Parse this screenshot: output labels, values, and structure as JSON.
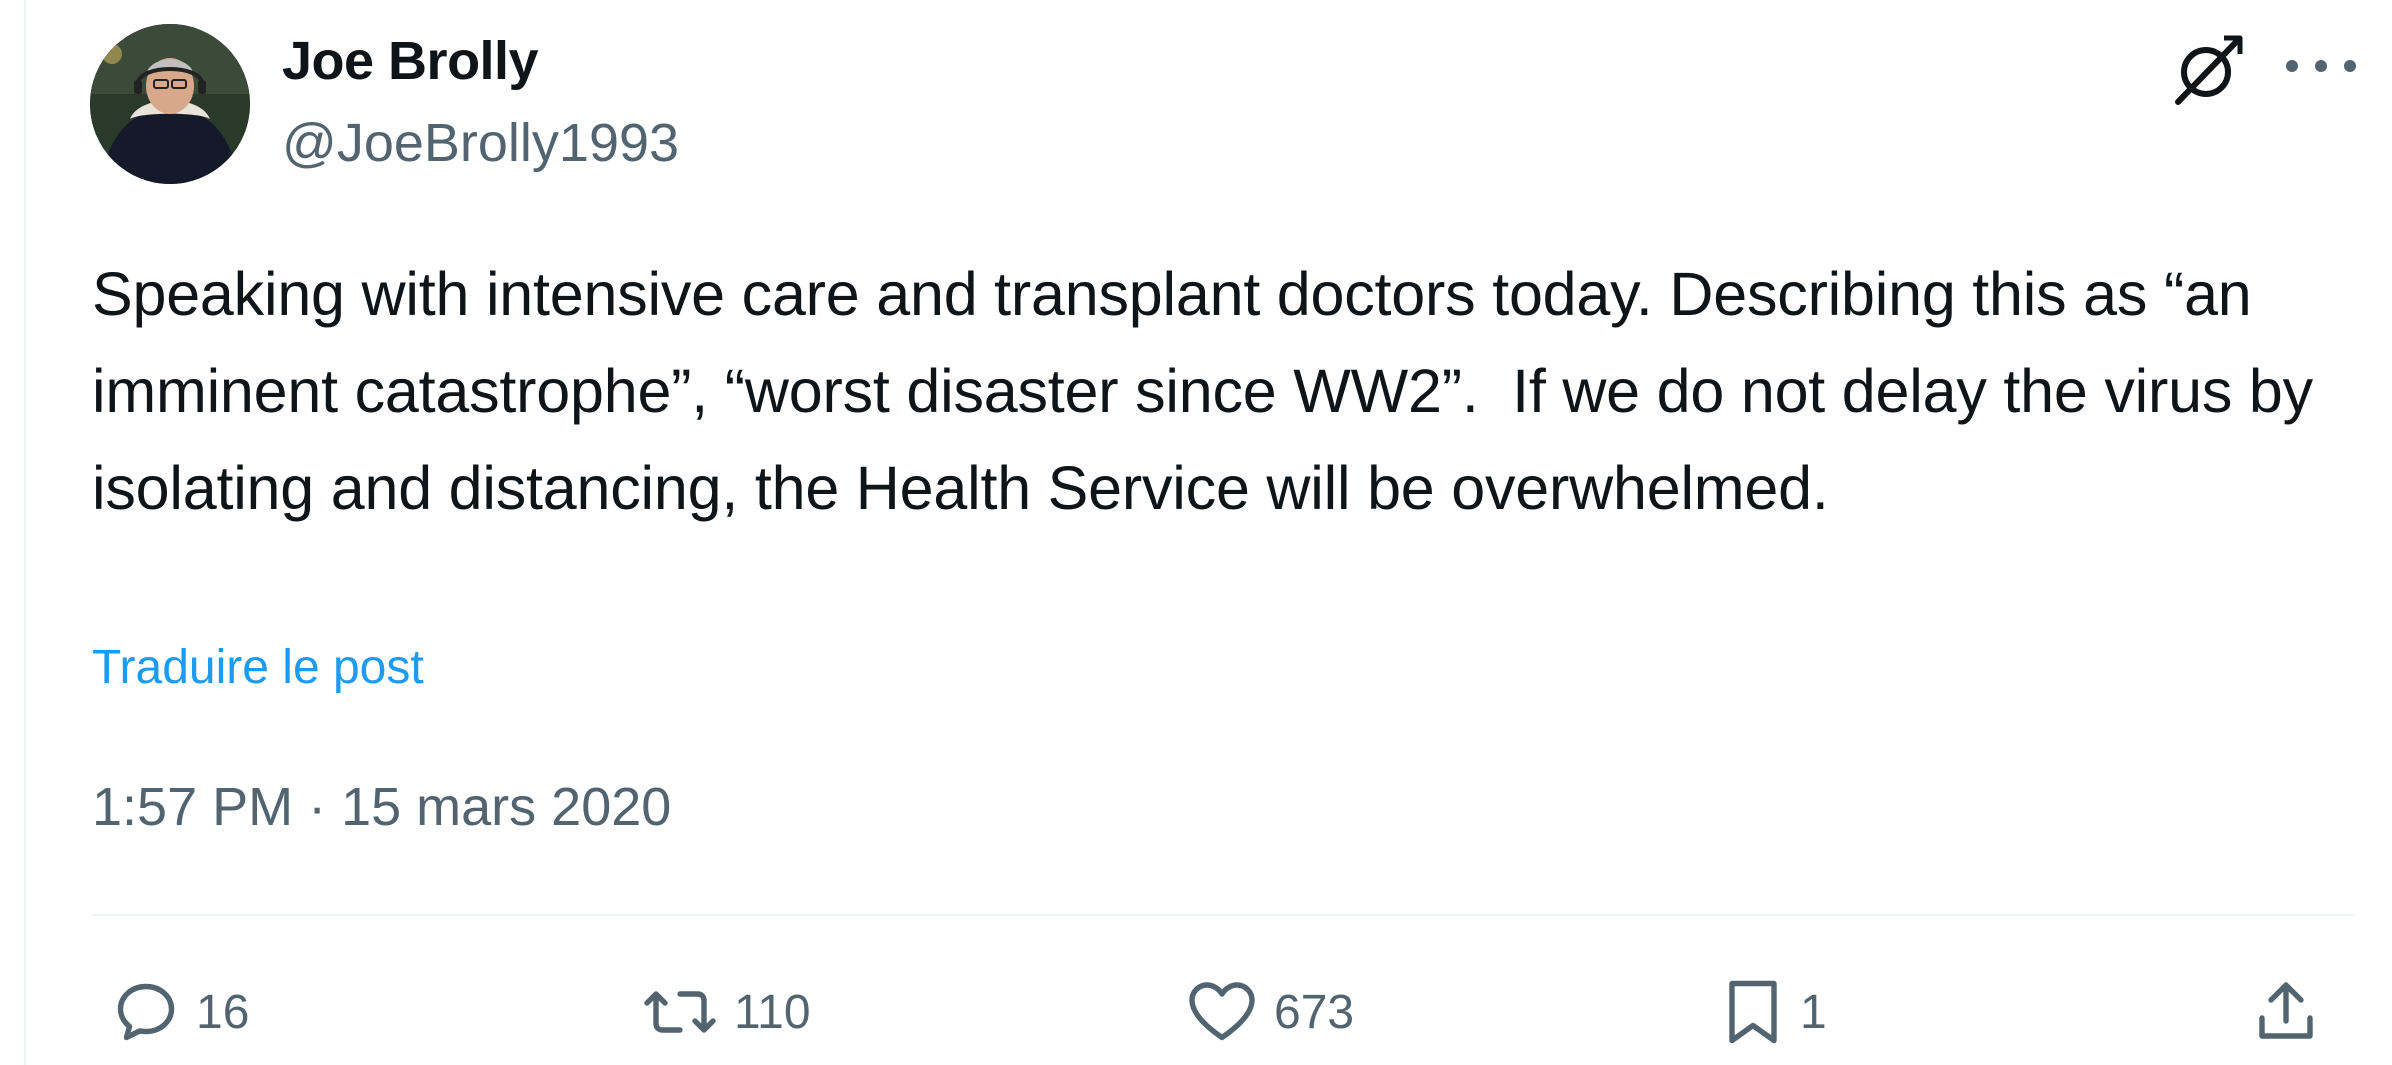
{
  "author": {
    "display_name": "Joe Brolly",
    "handle": "@JoeBrolly1993"
  },
  "tweet": {
    "text": "Speaking with intensive care and transplant doctors today. Describing this as “an imminent catastrophe”, “worst disaster since WW2”.  If we do not delay the virus by isolating and distancing, the Health Service will be overwhelmed.",
    "translate_label": "Traduire le post",
    "timestamp": "1:57 PM · 15 mars 2020"
  },
  "actions": {
    "replies": "16",
    "retweets": "110",
    "likes": "673",
    "bookmarks": "1"
  },
  "icons": {
    "header": [
      "grok-icon",
      "more-icon"
    ],
    "actions": [
      "reply-icon",
      "retweet-icon",
      "like-icon",
      "bookmark-icon",
      "share-icon"
    ]
  },
  "colors": {
    "text": "#0f1419",
    "secondary": "#536471",
    "link": "#1d9bf0",
    "divider": "#eff3f4"
  }
}
